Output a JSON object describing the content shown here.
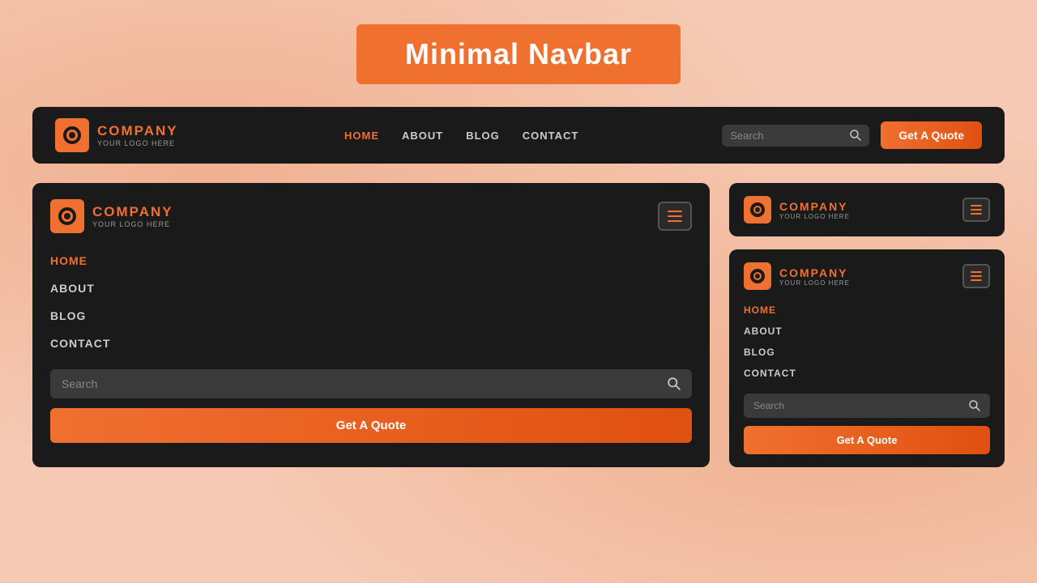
{
  "page": {
    "title": "Minimal Navbar",
    "background": "#f5c9b3"
  },
  "brand": {
    "company": "COMPANY",
    "tagline": "YOUR LOGO HERE"
  },
  "nav": {
    "links": [
      {
        "label": "HOME",
        "active": true
      },
      {
        "label": "ABOUT",
        "active": false
      },
      {
        "label": "BLOG",
        "active": false
      },
      {
        "label": "CONTACT",
        "active": false
      }
    ],
    "search_placeholder": "Search",
    "quote_button": "Get A Quote"
  },
  "navbar1": {
    "search_placeholder": "Search",
    "quote_label": "Get A Quote"
  },
  "navbar2": {
    "search_placeholder": "Search",
    "quote_label": "Get A Quote",
    "links": [
      "HOME",
      "ABOUT",
      "BLOG",
      "CONTACT"
    ]
  },
  "navbar3": {
    "company": "COMPANY",
    "tagline": "YOUR LOGO HERE"
  },
  "navbar4": {
    "search_placeholder": "Search",
    "quote_label": "Get A Quote",
    "links": [
      "HOME",
      "ABOUT",
      "BLOG",
      "CONTACT"
    ]
  }
}
